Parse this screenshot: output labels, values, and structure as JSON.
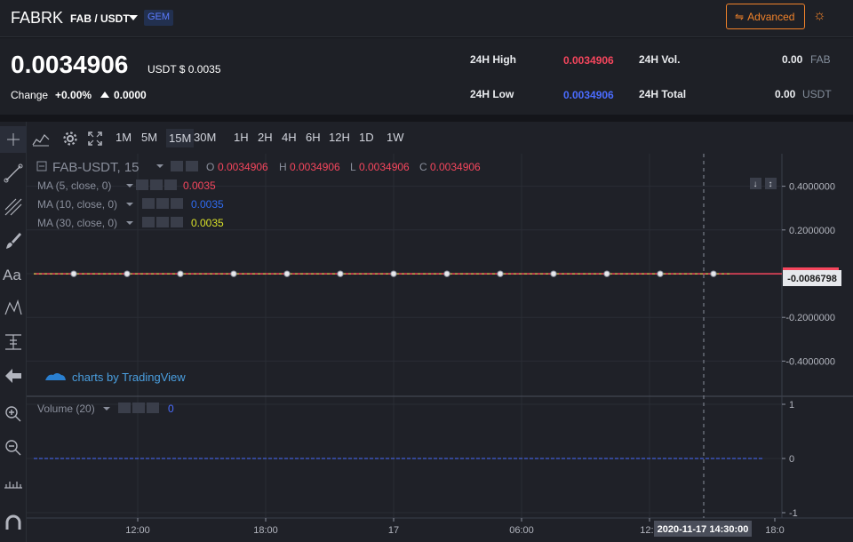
{
  "header": {
    "brand": "FABRK",
    "pair": "FAB / USDT",
    "badge": "GEM",
    "advanced_label": "Advanced"
  },
  "ticker": {
    "last_price": "0.0034906",
    "quote_label": "USDT $ 0.0035",
    "change_label": "Change",
    "change_pct": "+0.00%",
    "change_abs": "0.0000",
    "high_label": "24H High",
    "high_value": "0.0034906",
    "low_label": "24H Low",
    "low_value": "0.0034906",
    "vol_label": "24H Vol.",
    "vol_value": "0.00",
    "vol_unit": "FAB",
    "total_label": "24H Total",
    "total_value": "0.00",
    "total_unit": "USDT"
  },
  "colors": {
    "accent": "#f0822a",
    "up": "#f6465d",
    "low_blue": "#4a6cff",
    "ma5": "#f6465d",
    "ma10": "#2f6bf0",
    "ma30": "#d8e028",
    "volume": "#4a6cff"
  },
  "toolbar": {
    "timeframes": [
      "1M",
      "5M",
      "15M",
      "30M",
      "1H",
      "2H",
      "4H",
      "6H",
      "12H",
      "1D",
      "1W"
    ],
    "selected": "15M"
  },
  "legend": {
    "symbol": "FAB-USDT, 15",
    "o_label": "O",
    "o_value": "0.0034906",
    "h_label": "H",
    "h_value": "0.0034906",
    "l_label": "L",
    "l_value": "0.0034906",
    "c_label": "C",
    "c_value": "0.0034906",
    "ma5_label": "MA (5, close, 0)",
    "ma5_value": "0.0035",
    "ma10_label": "MA (10, close, 0)",
    "ma10_value": "0.0035",
    "ma30_label": "MA (30, close, 0)",
    "ma30_value": "0.0035",
    "volume_label": "Volume (20)",
    "volume_value": "0",
    "watermark": "charts by TradingView"
  },
  "price_axis": {
    "ticks": [
      "0.4000000",
      "0.2000000",
      "-0.2000000",
      "-0.4000000"
    ],
    "current_label": "-0.0086798"
  },
  "volume_axis": {
    "ticks": [
      "1",
      "0",
      "-1"
    ]
  },
  "time_axis": {
    "ticks": [
      "12:00",
      "18:00",
      "17",
      "06:00",
      "12:0",
      "18:0"
    ],
    "crosshair_label": "2020-11-17 14:30:00"
  },
  "chart_data": {
    "type": "line",
    "title": "FAB-USDT, 15",
    "series": [
      {
        "name": "MA (5, close, 0)",
        "values": [
          0.0035,
          0.0035,
          0.0035,
          0.0035,
          0.0035,
          0.0035,
          0.0035,
          0.0035,
          0.0035,
          0.0035,
          0.0035,
          0.0035,
          0.0035
        ]
      },
      {
        "name": "MA (10, close, 0)",
        "values": [
          0.0035,
          0.0035,
          0.0035,
          0.0035,
          0.0035,
          0.0035,
          0.0035,
          0.0035,
          0.0035,
          0.0035,
          0.0035,
          0.0035,
          0.0035
        ]
      },
      {
        "name": "MA (30, close, 0)",
        "values": [
          0.0035,
          0.0035,
          0.0035,
          0.0035,
          0.0035,
          0.0035,
          0.0035,
          0.0035,
          0.0035,
          0.0035,
          0.0035,
          0.0035,
          0.0035
        ]
      }
    ],
    "volume": {
      "name": "Volume (20)",
      "value": 0
    },
    "ylim": [
      -0.5,
      0.5
    ],
    "grid": true
  }
}
